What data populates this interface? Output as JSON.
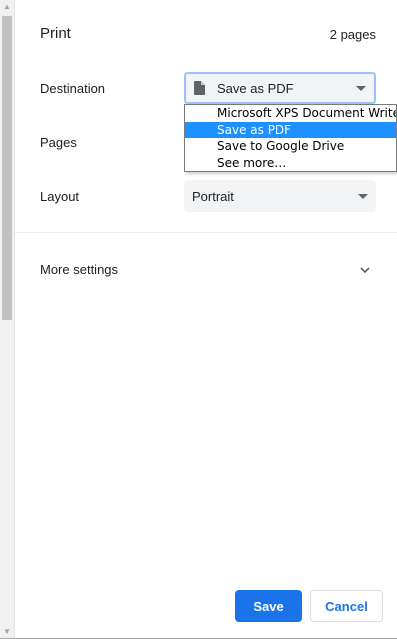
{
  "dialog": {
    "title": "Print",
    "page_count": "2 pages"
  },
  "destination": {
    "label": "Destination",
    "value": "Save as PDF",
    "icon": "document-icon",
    "options": [
      {
        "label": "Microsoft XPS Document Writer",
        "selected": false
      },
      {
        "label": "Save as PDF",
        "selected": true
      },
      {
        "label": "Save to Google Drive",
        "selected": false
      },
      {
        "label": "See more…",
        "selected": false
      }
    ]
  },
  "pages": {
    "label": "Pages"
  },
  "layout": {
    "label": "Layout",
    "value": "Portrait"
  },
  "more_settings": {
    "label": "More settings"
  },
  "actions": {
    "save_label": "Save",
    "cancel_label": "Cancel"
  },
  "colors": {
    "accent": "#1a73e8",
    "dropdown_highlight": "#1e90ff",
    "select_bg": "#f1f3f4"
  }
}
